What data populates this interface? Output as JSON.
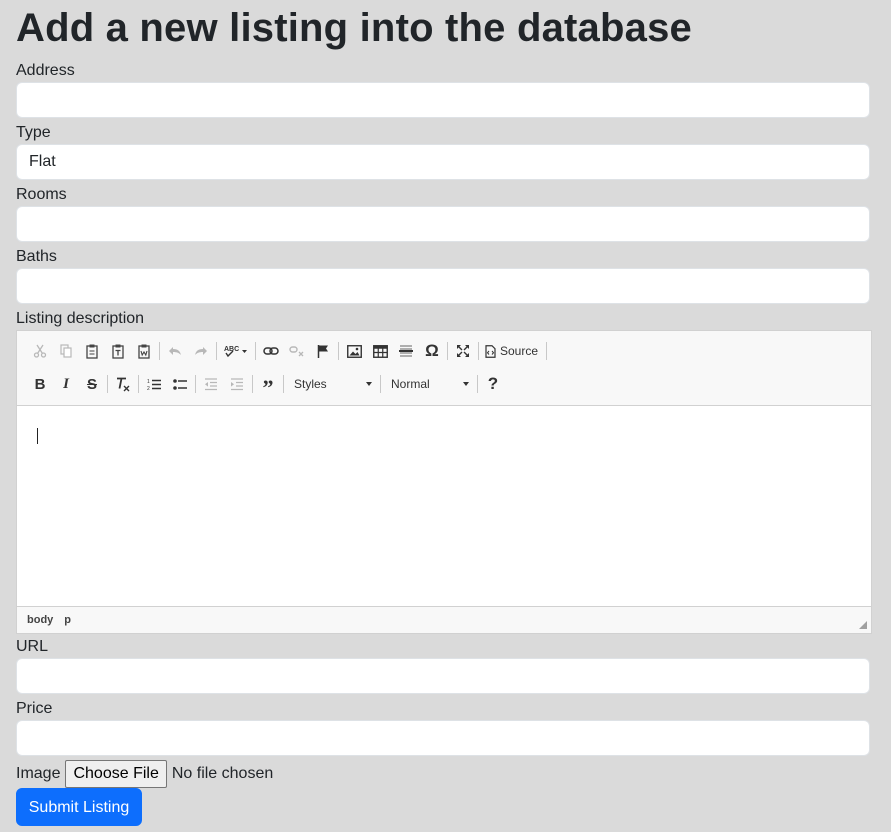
{
  "page_title": "Add a new listing into the database",
  "fields": {
    "address": {
      "label": "Address",
      "value": ""
    },
    "type": {
      "label": "Type",
      "value": "Flat"
    },
    "rooms": {
      "label": "Rooms",
      "value": ""
    },
    "baths": {
      "label": "Baths",
      "value": ""
    },
    "description": {
      "label": "Listing description"
    },
    "url": {
      "label": "URL",
      "value": ""
    },
    "price": {
      "label": "Price",
      "value": ""
    },
    "image": {
      "label": "Image",
      "choose_button": "Choose File",
      "status": "No file chosen"
    }
  },
  "editor": {
    "source_label": "Source",
    "styles_label": "Styles",
    "format_label": "Normal",
    "path": [
      "body",
      "p"
    ]
  },
  "submit_label": "Submit Listing",
  "colors": {
    "background": "#dadada",
    "accent": "#0d6efd"
  }
}
